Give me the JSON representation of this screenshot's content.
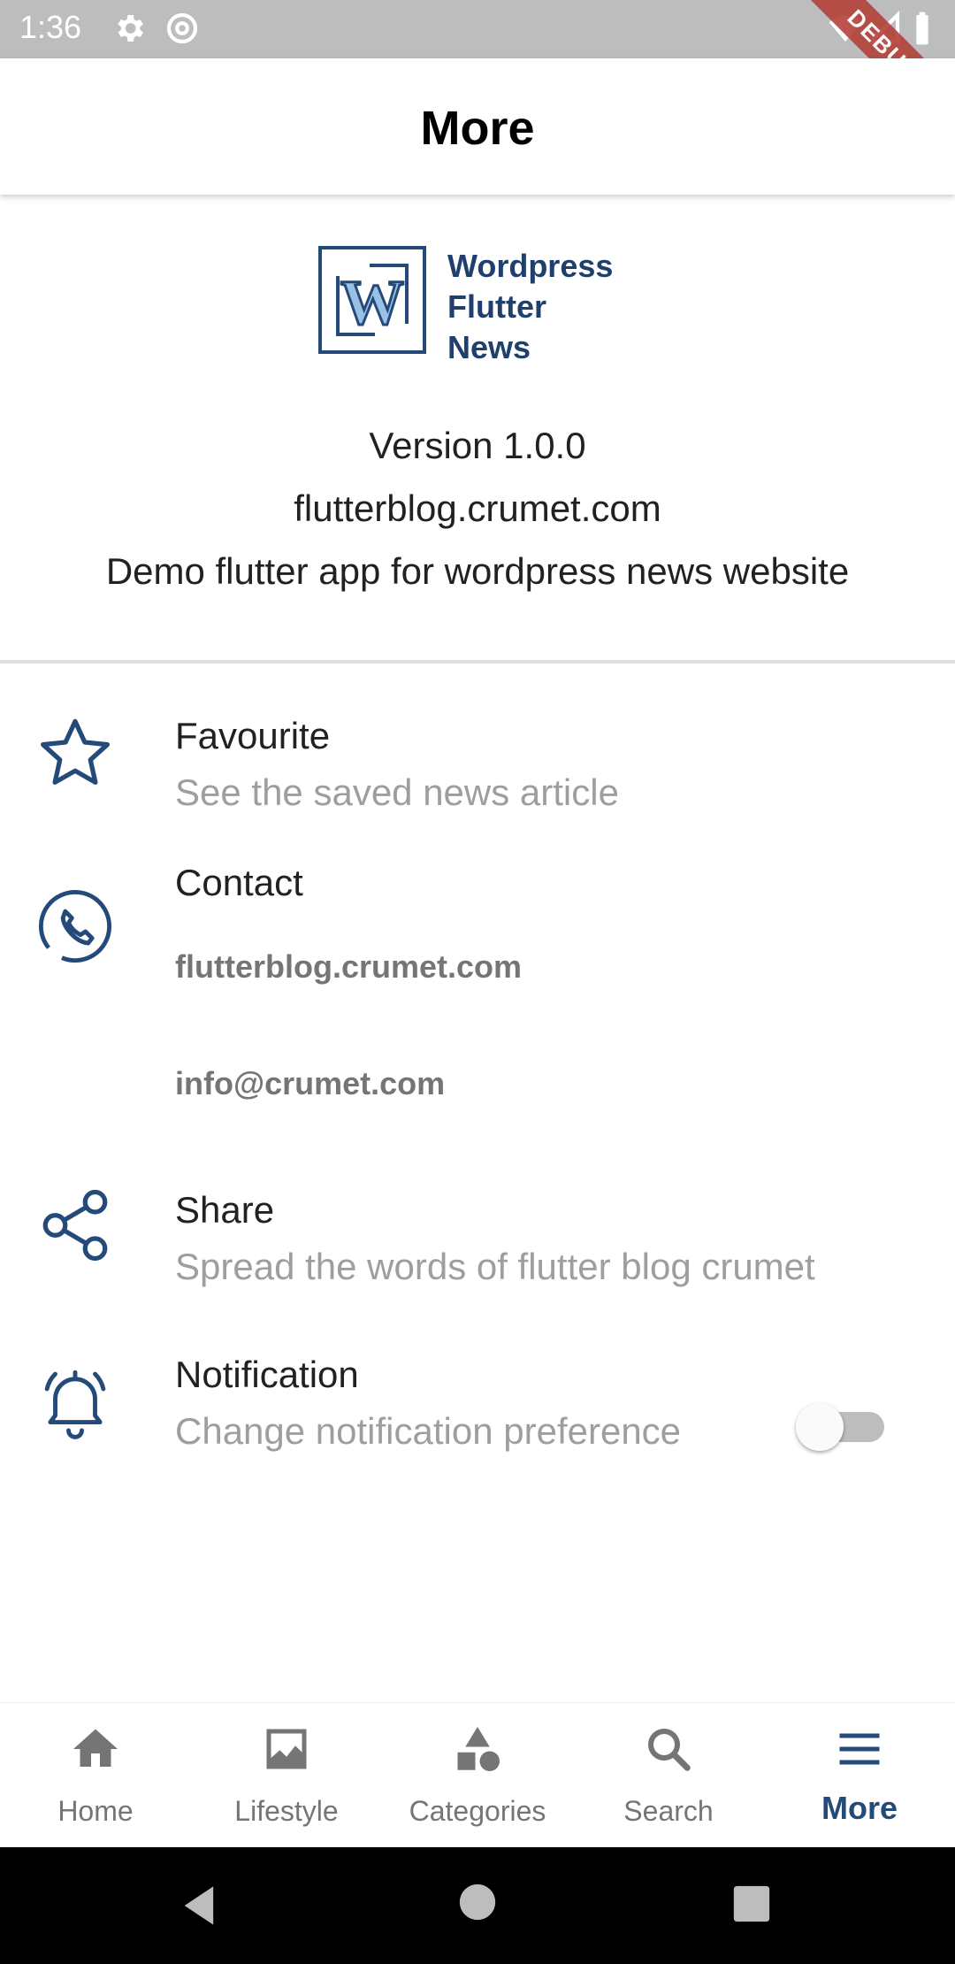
{
  "status_bar": {
    "time": "1:36",
    "debug_label": "DEBUG"
  },
  "app_bar": {
    "title": "More"
  },
  "logo": {
    "line1": "Wordpress",
    "line2": "Flutter",
    "line3": "News",
    "letter": "W"
  },
  "about": {
    "version": "Version 1.0.0",
    "website": "flutterblog.crumet.com",
    "description": "Demo flutter app for wordpress news website"
  },
  "menu": {
    "favourite": {
      "title": "Favourite",
      "subtitle": "See the saved news article"
    },
    "contact": {
      "title": "Contact",
      "website": "flutterblog.crumet.com",
      "email": "info@crumet.com"
    },
    "share": {
      "title": "Share",
      "subtitle": "Spread the words of flutter blog crumet"
    },
    "notification": {
      "title": "Notification",
      "subtitle": "Change notification preference",
      "enabled": false
    }
  },
  "bottom_nav": {
    "items": [
      {
        "label": "Home",
        "icon": "home-icon"
      },
      {
        "label": "Lifestyle",
        "icon": "image-icon"
      },
      {
        "label": "Categories",
        "icon": "categories-icon"
      },
      {
        "label": "Search",
        "icon": "search-icon"
      },
      {
        "label": "More",
        "icon": "menu-icon"
      }
    ],
    "active": "More"
  },
  "colors": {
    "accent": "#234a78",
    "muted": "#757575"
  }
}
